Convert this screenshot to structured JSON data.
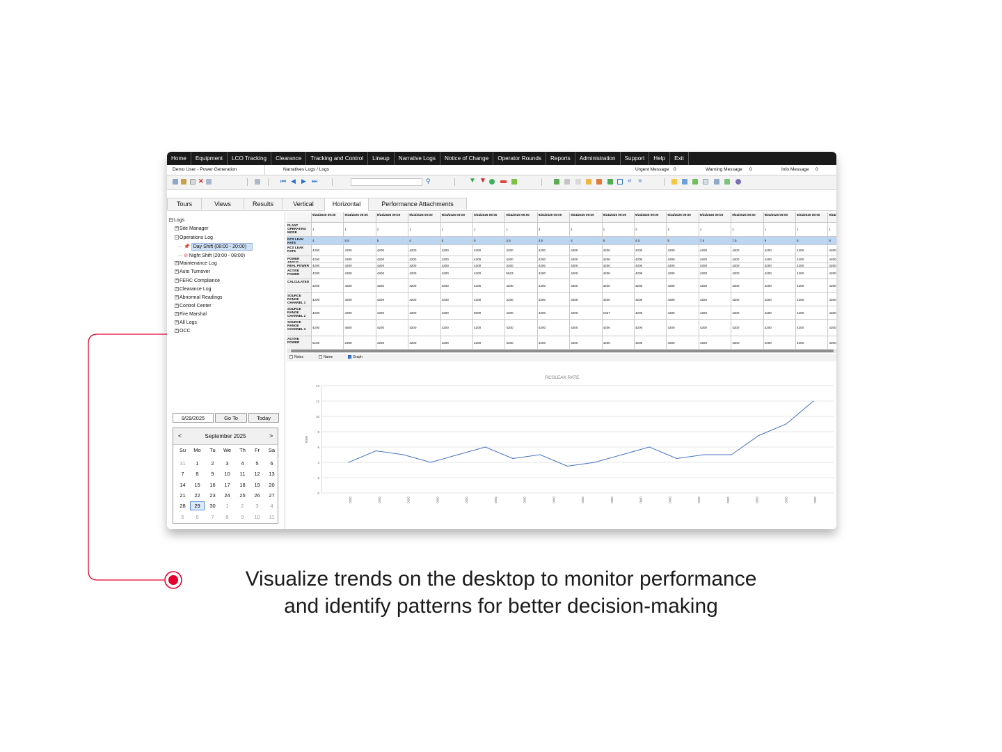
{
  "menu": [
    "Home",
    "Equipment",
    "LCO Tracking",
    "Clearance",
    "Tracking and Control",
    "Lineup",
    "Narrative Logs",
    "Notice of Change",
    "Operator Rounds",
    "Reports",
    "Administration",
    "Support",
    "Help",
    "Exit"
  ],
  "infobar": {
    "user": "Demo User - Power Generation",
    "breadcrumb": "Narratives Logs / Logs",
    "urgent_label": "Urgent Message",
    "urgent_count": "0",
    "warning_label": "Warning Message",
    "warning_count": "0",
    "info_label": "Info Message",
    "info_count": "0"
  },
  "toolbar": {
    "search_value": ""
  },
  "tabs": [
    "Tours",
    "Views",
    "Results",
    "Vertical",
    "Horizontal",
    "Performance Attachments"
  ],
  "active_tab": "Horizontal",
  "tree": [
    {
      "label": "Logs",
      "level": 0,
      "exp": "-"
    },
    {
      "label": "Site Manager",
      "level": 1,
      "exp": "+"
    },
    {
      "label": "Operations Log",
      "level": 1,
      "exp": "-"
    },
    {
      "label": "Day Shift (08:00 - 20:00)",
      "level": 2,
      "exp": "",
      "selected": true,
      "icon": "pin-icon"
    },
    {
      "label": "Night Shift (20:00 - 08:00)",
      "level": 2,
      "exp": "",
      "icon": "no-entry-icon"
    },
    {
      "label": "Maintenance Log",
      "level": 1,
      "exp": "+"
    },
    {
      "label": "Auto Turnover",
      "level": 1,
      "exp": "+"
    },
    {
      "label": "FERC Compliance",
      "level": 1,
      "exp": "+"
    },
    {
      "label": "Clearance Log",
      "level": 1,
      "exp": "+"
    },
    {
      "label": "Abnormal Readings",
      "level": 1,
      "exp": "+"
    },
    {
      "label": "Control Center",
      "level": 1,
      "exp": "+"
    },
    {
      "label": "Fire Marshal",
      "level": 1,
      "exp": "+"
    },
    {
      "label": "All Logs",
      "level": 1,
      "exp": "+"
    },
    {
      "label": "OCC",
      "level": 1,
      "exp": "+"
    }
  ],
  "date_nav": {
    "date": "9/29/2025",
    "goto_label": "Go To",
    "today_label": "Today"
  },
  "calendar": {
    "prev": "<",
    "next": ">",
    "month": "September 2025",
    "weekdays": [
      "Su",
      "Mo",
      "Tu",
      "We",
      "Th",
      "Fr",
      "Sa"
    ],
    "weeks": [
      [
        "31",
        "1",
        "2",
        "3",
        "4",
        "5",
        "6"
      ],
      [
        "7",
        "8",
        "9",
        "10",
        "11",
        "12",
        "13"
      ],
      [
        "14",
        "15",
        "16",
        "17",
        "18",
        "19",
        "20"
      ],
      [
        "21",
        "22",
        "23",
        "24",
        "25",
        "26",
        "27"
      ],
      [
        "28",
        "29",
        "30",
        "1",
        "2",
        "3",
        "4"
      ],
      [
        "5",
        "6",
        "7",
        "8",
        "9",
        "10",
        "11"
      ]
    ],
    "selected": "29"
  },
  "grid": {
    "col_header": "9/24/2025 09:00",
    "rows": [
      {
        "label": "PLANT OPERATING MODE",
        "values": [
          "1",
          "1",
          "2",
          "1",
          "1",
          "1",
          "1",
          "2",
          "1",
          "1",
          "2",
          "2",
          "1",
          "1",
          "1",
          "1",
          "1"
        ]
      },
      {
        "label": "RCS LEAK RATE",
        "highlight": true,
        "values": [
          "4",
          "5.5",
          "5",
          "4",
          "5",
          "6",
          "4.5",
          "3.5",
          "4",
          "6",
          "4.5",
          "5",
          "7.5",
          "7.5",
          "9",
          "5",
          "6"
        ]
      },
      {
        "label": "RCS LEAK RATE",
        "values": [
          "4200",
          "4200",
          "4200",
          "4200",
          "4200",
          "4200",
          "4200",
          "4200",
          "4200",
          "4200",
          "4200",
          "4200",
          "4200",
          "4200",
          "4200",
          "4200",
          "4200"
        ]
      },
      {
        "label": "POWER ANGLE",
        "values": [
          "4200",
          "4200",
          "4200",
          "4200",
          "4200",
          "4200",
          "4200",
          "4200",
          "4200",
          "4200",
          "4200",
          "4200",
          "4200",
          "4200",
          "4200",
          "4200",
          "4200"
        ]
      },
      {
        "label": "REAL POWER",
        "values": [
          "4200",
          "4200",
          "4200",
          "4200",
          "4200",
          "4200",
          "4200",
          "4200",
          "4200",
          "4200",
          "4200",
          "4200",
          "4200",
          "4200",
          "4200",
          "4200",
          "4200"
        ]
      },
      {
        "label": "ACTIVE POWER",
        "values": [
          "4200",
          "4200",
          "4200",
          "4200",
          "4200",
          "4200",
          "5523",
          "4200",
          "4200",
          "4200",
          "4200",
          "4200",
          "4200",
          "4200",
          "4200",
          "4200",
          "4200"
        ]
      },
      {
        "label": "CALCULATED",
        "values": [
          "4200",
          "4200",
          "4200",
          "4200",
          "4200",
          "4200",
          "4200",
          "4200",
          "4200",
          "4200",
          "4200",
          "4200",
          "4200",
          "4200",
          "4200",
          "4200",
          "4200"
        ]
      },
      {
        "label": "SOURCE RANGE CHANNEL 1",
        "values": [
          "4200",
          "4200",
          "4200",
          "4200",
          "4200",
          "4200",
          "4200",
          "4200",
          "4200",
          "4200",
          "4200",
          "4200",
          "4200",
          "4200",
          "4200",
          "4200",
          "4200"
        ]
      },
      {
        "label": "SOURCE RANGE CHANNEL 2",
        "values": [
          "4200",
          "4200",
          "4200",
          "4200",
          "4200",
          "5000",
          "4200",
          "4200",
          "4200",
          "1027",
          "4200",
          "4200",
          "4200",
          "4200",
          "4200",
          "4200",
          "4200"
        ]
      },
      {
        "label": "SOURCE RANGE CHANNEL 3",
        "values": [
          "4200",
          "4500",
          "4200",
          "4200",
          "4200",
          "4200",
          "4200",
          "4200",
          "4200",
          "4200",
          "4200",
          "4200",
          "4200",
          "4200",
          "4200",
          "4200",
          "4200"
        ]
      },
      {
        "label": "ACTIVE POWER",
        "values": [
          "5100",
          "2399",
          "4200",
          "4200",
          "4200",
          "4200",
          "4200",
          "4200",
          "4200",
          "4200",
          "4200",
          "4200",
          "4200",
          "4200",
          "4200",
          "4200",
          "4200"
        ]
      }
    ]
  },
  "options": [
    {
      "label": "Notes",
      "checked": false
    },
    {
      "label": "Name",
      "checked": false
    },
    {
      "label": "Graph",
      "checked": true
    }
  ],
  "chart_data": {
    "type": "line",
    "title": "RCSLEAK RATE",
    "ylabel": "0000",
    "x": [
      "0000",
      "0000",
      "0000",
      "0000",
      "0000",
      "0000",
      "0000",
      "0000",
      "0000",
      "0000",
      "0000",
      "0000",
      "0000",
      "0000",
      "0000",
      "0000",
      "0000"
    ],
    "series": [
      {
        "values": [
          4,
          5.5,
          5,
          4,
          5,
          6,
          4.5,
          5,
          3.5,
          4,
          5,
          6,
          4.5,
          5,
          5,
          7.5,
          9,
          12
        ]
      }
    ],
    "ylim": [
      0,
      14
    ],
    "yticks": [
      0,
      2,
      4,
      6,
      8,
      10,
      12,
      14
    ],
    "grid": true,
    "color": "#4472c4"
  },
  "caption": {
    "line1": "Visualize trends on the desktop to monitor performance",
    "line2": "and identify patterns for better decision-making"
  },
  "accent_color": "#e4002b"
}
